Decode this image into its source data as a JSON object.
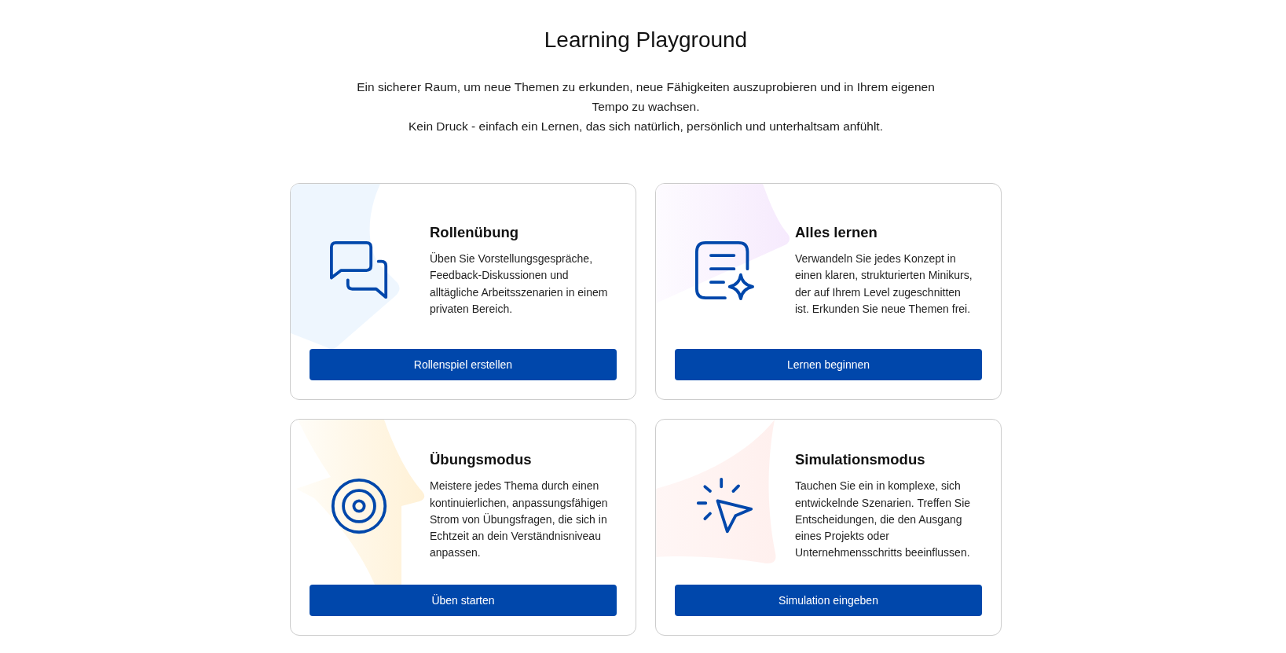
{
  "header": {
    "title": "Learning Playground",
    "intro": [
      "Ein sicherer Raum, um neue Themen zu erkunden, neue Fähigkeiten auszuprobieren und in Ihrem eigenen Tempo zu wachsen.",
      "Kein Druck - einfach ein Lernen, das sich natürlich, persönlich und unterhaltsam anfühlt."
    ]
  },
  "cards": [
    {
      "kind": "chat",
      "title": "Rollenübung",
      "description": "Üben Sie Vorstellungsgespräche, Feedback-Diskussionen und alltägliche Arbeitsszenarien in einem privaten Bereich.",
      "button": "Rollenspiel erstellen"
    },
    {
      "kind": "document",
      "title": "Alles lernen",
      "description": "Verwandeln Sie jedes Konzept in einen klaren, strukturierten Minikurs, der auf Ihrem Level zugeschnitten ist. Erkunden Sie neue Themen frei.",
      "button": "Lernen beginnen"
    },
    {
      "kind": "target",
      "title": "Übungsmodus",
      "description": "Meistere jedes Thema durch einen kontinuierlichen, anpassungsfähigen Strom von Übungsfragen, die sich in Echtzeit an dein Verständnisniveau anpassen.",
      "button": "Üben starten"
    },
    {
      "kind": "pointer",
      "title": "Simulationsmodus",
      "description": "Tauchen Sie ein in komplexe, sich entwickelnde Szenarien. Treffen Sie Entscheidungen, die den Ausgang eines Projekts oder Unternehmensschritts beeinflussen.",
      "button": "Simulation eingeben"
    }
  ]
}
